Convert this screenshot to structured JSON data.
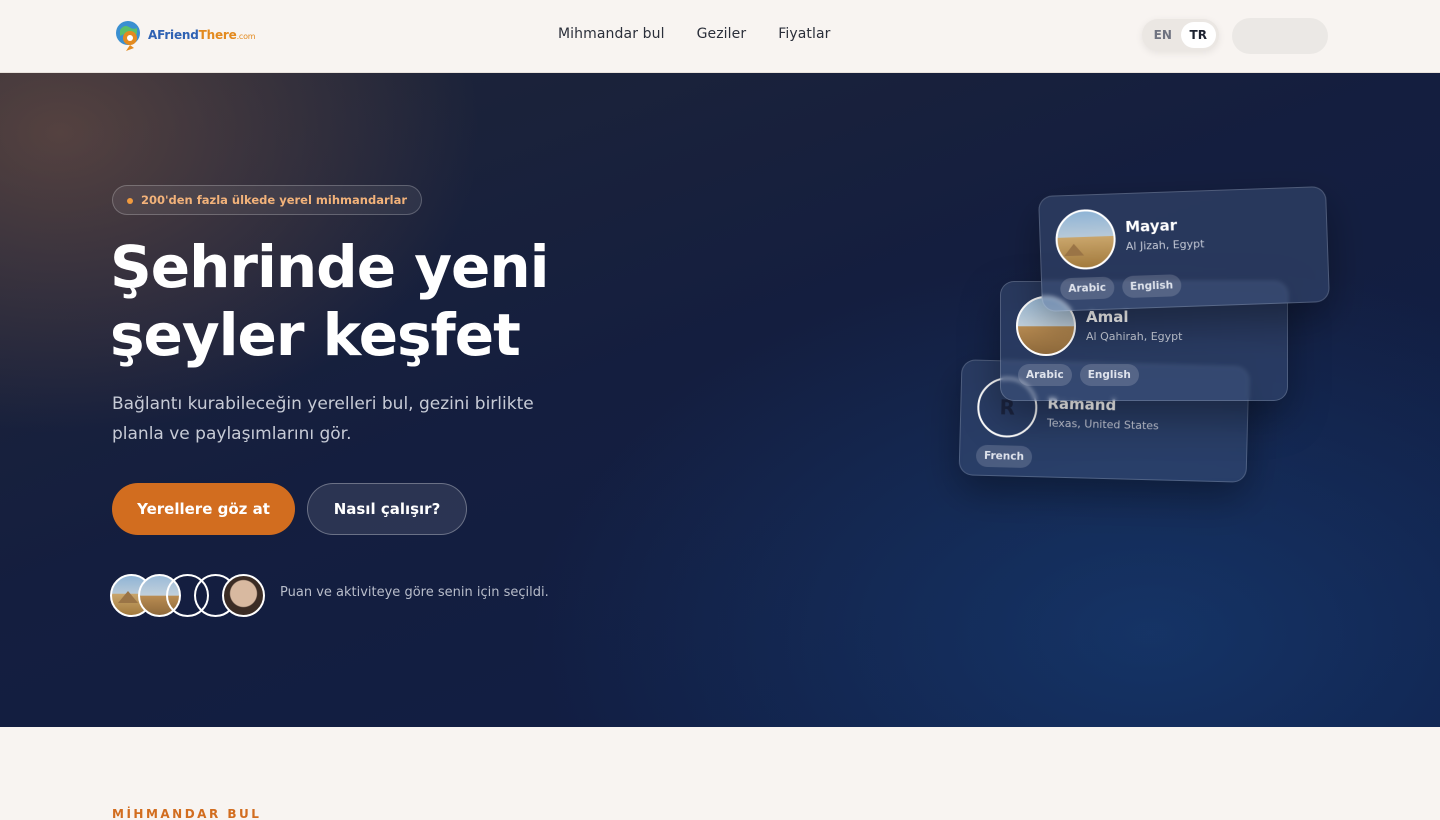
{
  "brand": {
    "name_part1": "AFriend",
    "name_part2": "There",
    "domain": ".com",
    "colors": {
      "accent": "#d26d1f",
      "logo_blue": "#2f62b3",
      "logo_orange": "#e38a1f",
      "hero_bg": "#141e3f"
    }
  },
  "nav": {
    "links": [
      "Mihmandar bul",
      "Geziler",
      "Fiyatlar"
    ],
    "lang": {
      "options": [
        "EN",
        "TR"
      ],
      "active": "TR"
    }
  },
  "hero": {
    "badge": "200'den fazla ülkede yerel mihmandarlar",
    "headline_line1": "Şehrinde yeni",
    "headline_line2": "şeyler keşfet",
    "subtext": "Bağlantı kurabileceğin yerelleri bul, gezini birlikte planla ve paylaşımlarını gör.",
    "primary_cta": "Yerellere göz at",
    "secondary_cta": "Nasıl çalışır?",
    "avatars_caption": "Puan ve aktiviteye göre senin için seçildi.",
    "cards": [
      {
        "name": "Mayar",
        "location": "Al Jizah, Egypt",
        "tags": [
          "Arabic",
          "English"
        ]
      },
      {
        "name": "Amal",
        "location": "Al Qahirah, Egypt",
        "tags": [
          "Arabic",
          "English"
        ]
      },
      {
        "name": "Ramand",
        "location": "Texas, United States",
        "tags": [
          "French"
        ],
        "initial": "R"
      }
    ]
  },
  "section": {
    "label": "MİHMANDAR BUL"
  }
}
